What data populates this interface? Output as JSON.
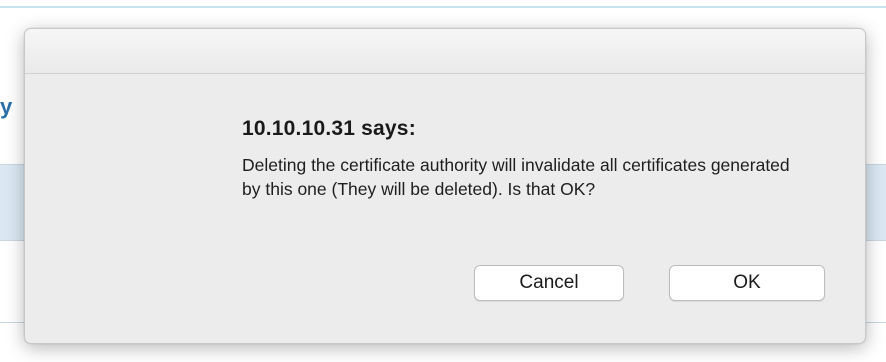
{
  "background": {
    "header_fragment": "y"
  },
  "dialog": {
    "title": "10.10.10.31 says:",
    "message": "Deleting the certificate authority will invalidate all certificates generated by this one (They will be deleted). Is that OK?",
    "cancel_label": "Cancel",
    "ok_label": "OK"
  },
  "colors": {
    "link_blue": "#2a6fa8",
    "row_highlight": "#dbe8f3",
    "dialog_bg": "#ececec"
  }
}
